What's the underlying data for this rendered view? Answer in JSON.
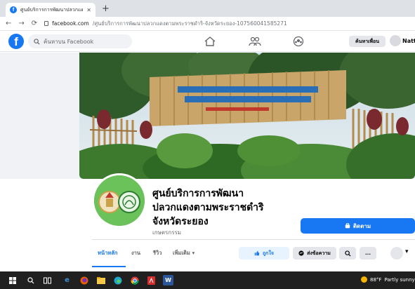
{
  "browser": {
    "tab_title": "ศูนย์บริการการพัฒนาปลวกแดงตามพ...",
    "tab_favicon": "f",
    "new_tab_glyph": "+",
    "tab_close_glyph": "✕",
    "url_domain": "facebook.com",
    "url_path": "/ศูนย์บริการการพัฒนาปลวกแดงตามพระราชดำริ-จังหวัดระยอง-107560041585271"
  },
  "header": {
    "logo": "f",
    "search_placeholder": "ค้นหาบน Facebook",
    "find_friends": "ค้นหาเพื่อน",
    "user_name": "Natta",
    "brand_color": "#1877f2"
  },
  "profile": {
    "name_line1": "ศูนย์บริการการพัฒนา",
    "name_line2": "ปลวกแดงตามพระราชดำริ",
    "name_line3": "จังหวัดระยอง",
    "category": "เกษตรกรรม",
    "follow_label": "ติดตาม"
  },
  "tabs": {
    "home": "หน้าหลัก",
    "jobs": "งาน",
    "reviews": "รีวิว",
    "more": "เพิ่มเติม ▾"
  },
  "actions": {
    "like": "ถูกใจ",
    "message": "ส่งข้อความ",
    "more": "...",
    "caret": "▾"
  },
  "taskbar": {
    "weather_temp": "88°F",
    "weather_text": "Partly sunny"
  }
}
